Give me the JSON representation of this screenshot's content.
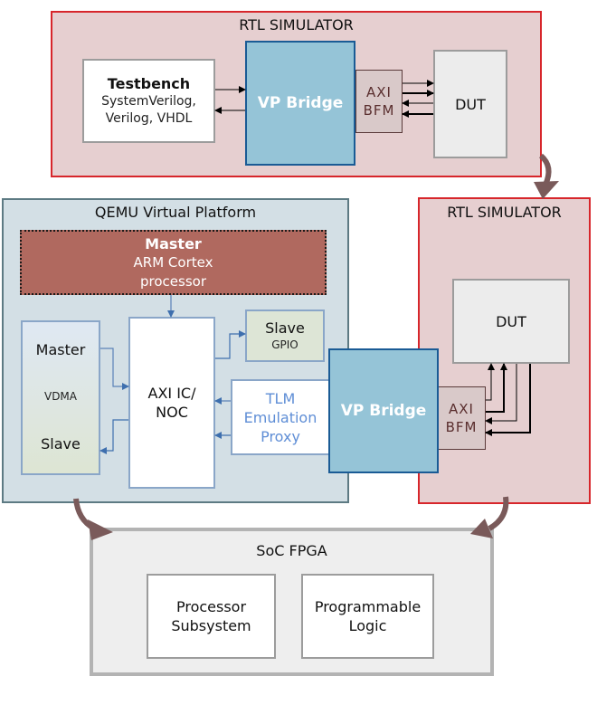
{
  "top_rtl_simulator": {
    "title": "RTL SIMULATOR",
    "testbench": {
      "title": "Testbench",
      "line1": "SystemVerilog,",
      "line2": "Verilog, VHDL"
    },
    "vp_bridge": "VP Bridge",
    "axi_bfm": {
      "line1": "AXI",
      "line2": "BFM"
    },
    "dut": "DUT"
  },
  "qemu_platform": {
    "title": "QEMU Virtual Platform",
    "arm": {
      "role": "Master",
      "line1": "ARM Cortex",
      "line2": "processor"
    },
    "vdma": {
      "master": "Master",
      "name": "VDMA",
      "slave": "Slave"
    },
    "axi_ic": {
      "line1": "AXI IC/",
      "line2": "NOC"
    },
    "gpio": {
      "role": "Slave",
      "name": "GPIO"
    },
    "tlm": {
      "line1": "TLM",
      "line2": "Emulation",
      "line3": "Proxy"
    }
  },
  "middle_vp_bridge": "VP Bridge",
  "right_rtl_simulator": {
    "title": "RTL SIMULATOR",
    "dut": "DUT",
    "axi_bfm": {
      "line1": "AXI",
      "line2": "BFM"
    }
  },
  "soc_fpga": {
    "title": "SoC FPGA",
    "processor": {
      "line1": "Processor",
      "line2": "Subsystem"
    },
    "logic": {
      "line1": "Programmable",
      "line2": "Logic"
    }
  },
  "colors": {
    "rtl_fill": "#e6cfd0",
    "rtl_border": "#d7262b",
    "qemu_fill": "#d3dfe5",
    "qemu_border": "#5d7a83",
    "vp_bridge_fill": "#95c4d7",
    "vp_bridge_border": "#1a5b95",
    "arm_fill": "#b0695f",
    "flow_arrow": "#7a5a5a",
    "bus_line": "#5b82b8"
  }
}
